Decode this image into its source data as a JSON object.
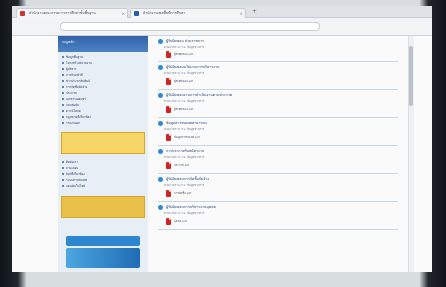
{
  "browser": {
    "tabs": [
      {
        "label": "สำนักงานคณะกรรมการการศึกษาขั้นพื้นฐาน",
        "close": "×"
      },
      {
        "label": "สำนักงานเขตพื้นที่การศึกษา",
        "close": "×"
      }
    ],
    "new_tab": "+"
  },
  "sidebar": {
    "header": "เมนูหลัก",
    "items": [
      "ข้อมูลพื้นฐาน",
      "โครงสร้างหน่วยงาน",
      "ผู้บริหาร",
      "ภารกิจหน้าที่",
      "ข่าวประชาสัมพันธ์",
      "การจัดซื้อจัดจ้าง",
      "ประกาศ",
      "เอกสารเผยแพร่",
      "แบบฟอร์ม",
      "ดาวน์โหลด",
      "กฎหมายที่เกี่ยวข้อง",
      "รายงานผล",
      "ติดต่อเรา",
      "ถาม-ตอบ",
      "ลิงก์ที่เกี่ยวข้อง",
      "ระบบสารสนเทศ",
      "แผนผังเว็บไซต์"
    ]
  },
  "rows": [
    {
      "title": "ผู้รับผิดชอบ ส่วนราชการ",
      "meta": "ตามมาตรา พ.ร.บ. ข้อมูลข่าวสาร",
      "file": "ผู้รับผิดชอบ.pdf"
    },
    {
      "title": "ผู้รับผิดชอบนโยบายการบริหารงาน",
      "meta": "ตามมาตรา พ.ร.บ. ข้อมูลข่าวสาร",
      "file": "ผู้รับผิดชอบ.pdf"
    },
    {
      "title": "ผู้รับผิดชอบงานการดำเนินงานตามประกาศ",
      "meta": "ตามมาตรา พ.ร.บ. ข้อมูลข่าวสาร",
      "file": "ผู้รับผิดชอบ.pdf"
    },
    {
      "title": "ข้อมูลสารสนเทศสาธารณะ",
      "meta": "ตามมาตรา พ.ร.บ. ข้อมูลข่าวสาร",
      "file": "ข้อมูลสารสนเทศ.pdf"
    },
    {
      "title": "การประกาศรับสมัครงาน",
      "meta": "ตามมาตรา พ.ร.บ. ข้อมูลข่าวสาร",
      "file": "ประกาศ.pdf"
    },
    {
      "title": "ผู้รับผิดชอบการจัดซื้อจัดจ้าง",
      "meta": "ตามมาตรา พ.ร.บ. ข้อมูลข่าวสาร",
      "file": "การจัดซื้อ.pdf"
    },
    {
      "title": "ผู้รับผิดชอบการบริหารงานบุคคล",
      "meta": "ตามมาตรา พ.ร.บ. ข้อมูลข่าวสาร",
      "file": "บุคคล.pdf"
    }
  ]
}
